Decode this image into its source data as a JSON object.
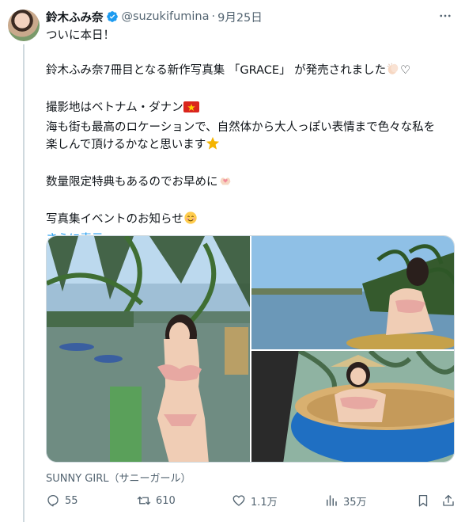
{
  "tweet": {
    "author_name": "鈴木ふみ奈",
    "handle": "@suzukifumina",
    "separator": "·",
    "date": "9月25日",
    "more_icon": "more-horizontal-icon",
    "lines": [
      "ついに本日！",
      "",
      "鈴木ふみ奈7冊目となる新作写真集 「GRACE」 が発売されました",
      "",
      "撮影地はベトナム・ダナン",
      "海も街も最高のロケーションで、自然体から大人っぽい表情まで色々な私を",
      "楽しんで頂けるかなと思います",
      "",
      "数量限定特典もあるのでお早めに",
      "",
      "写真集イベントのお知らせ"
    ],
    "inline_emojis": {
      "line3": "clapping-hands-icon",
      "line3_heart": "♡",
      "line5": "vietnam-flag-icon",
      "line7": "star-icon",
      "line9": "heart-hands-icon",
      "line11": "smiling-face-icon"
    },
    "show_more": "さらに表示",
    "source_label": "SUNNY GIRL（サニーガール）",
    "actions": {
      "replies": "55",
      "retweets": "610",
      "likes": "1.1万",
      "views": "35万"
    }
  },
  "colors": {
    "text": "#0f1419",
    "secondary": "#536471",
    "link": "#1d9bf0",
    "verified": "#1d9bf0",
    "divider": "#cfd9de"
  }
}
